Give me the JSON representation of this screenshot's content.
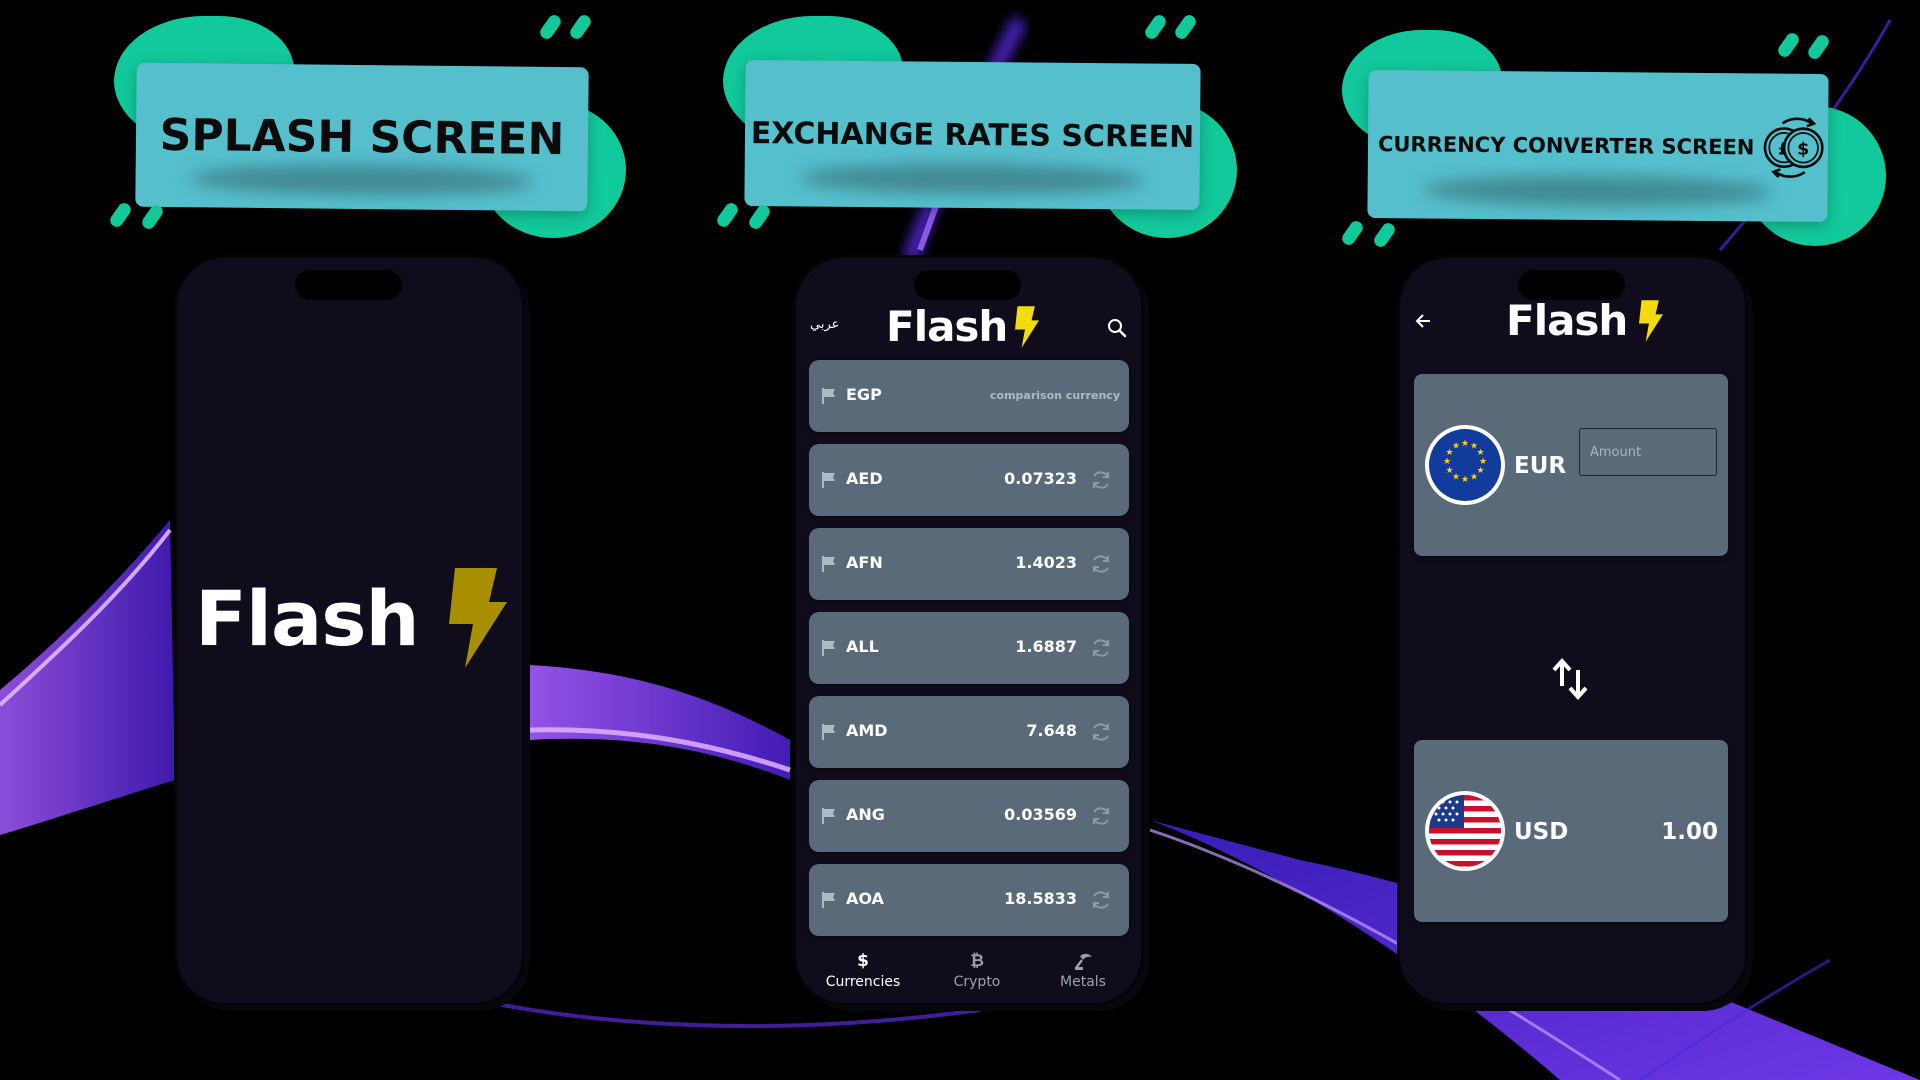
{
  "colors": {
    "background": "#000000",
    "banner_card": "#55bfcc",
    "banner_accent": "#12c99b",
    "phone_screen": "#110c1c",
    "row_card": "#5a6a78",
    "bolt_dim": "#a88f00",
    "bolt_bright": "#f2dc10",
    "glow": "#8a4dff"
  },
  "banners": {
    "splash": "SPLASH SCREEN",
    "exchange": "EXCHANGE RATES SCREEN",
    "converter": "CURRENCY CONVERTER SCREEN",
    "converter_icon": "currency-exchange-icon"
  },
  "app": {
    "name": "Flash"
  },
  "exchange": {
    "language_toggle": "عربي",
    "base_row": {
      "code": "EGP",
      "note": "comparison currency"
    },
    "rates": [
      {
        "code": "AED",
        "value": "0.07323"
      },
      {
        "code": "AFN",
        "value": "1.4023"
      },
      {
        "code": "ALL",
        "value": "1.6887"
      },
      {
        "code": "AMD",
        "value": "7.648"
      },
      {
        "code": "ANG",
        "value": "0.03569"
      },
      {
        "code": "AOA",
        "value": "18.5833"
      }
    ],
    "tabs": [
      {
        "label": "Currencies",
        "icon": "$",
        "active": true
      },
      {
        "label": "Crypto",
        "icon": "₿",
        "active": false
      },
      {
        "label": "Metals",
        "icon": "metals-icon",
        "active": false
      }
    ]
  },
  "converter": {
    "from": {
      "code": "EUR",
      "amount_placeholder": "Amount",
      "flag": "eu-flag-icon"
    },
    "to": {
      "code": "USD",
      "value": "1.00",
      "flag": "us-flag-icon"
    },
    "swap_icon": "swap-arrows-icon"
  }
}
